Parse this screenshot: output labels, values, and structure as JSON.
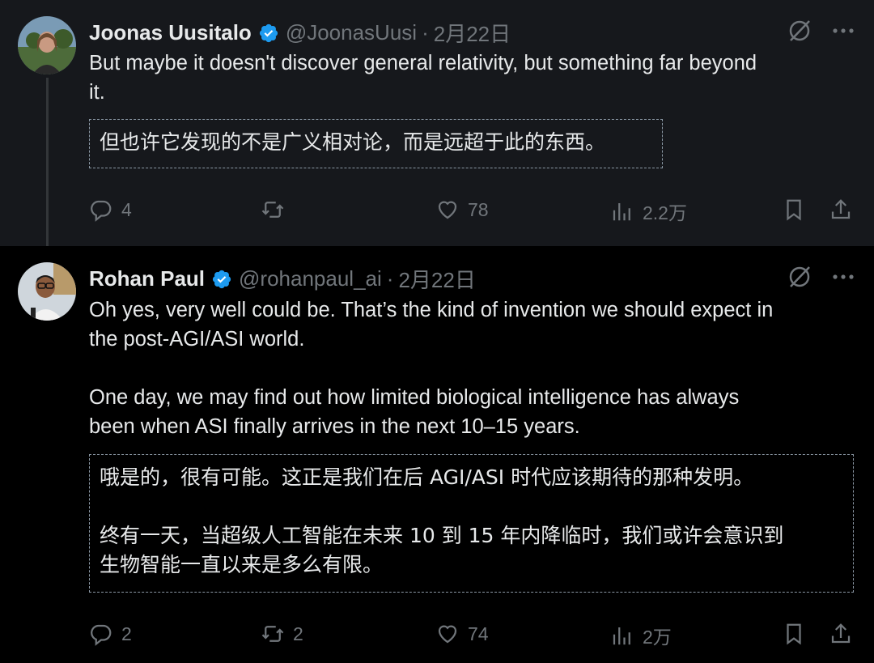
{
  "tweets": [
    {
      "author": "Joonas Uusitalo",
      "handle": "@JoonasUusi",
      "separator": "·",
      "date": "2月22日",
      "text": "But maybe it doesn't discover general relativity, but something far beyond\nit.",
      "translation": "但也许它发现的不是广义相对论，而是远超于此的东西。",
      "replies": "4",
      "retweets": "",
      "likes": "78",
      "views": "2.2万"
    },
    {
      "author": "Rohan Paul",
      "handle": "@rohanpaul_ai",
      "separator": "·",
      "date": "2月22日",
      "text": "Oh yes, very well could be. That’s the kind of invention we should expect in\nthe post-AGI/ASI world.\n\nOne day, we may find out how limited biological intelligence has always\nbeen when ASI finally arrives in the next 10–15 years.",
      "translation": "哦是的，很有可能。这正是我们在后 AGI/ASI 时代应该期待的那种发明。\n\n终有一天，当超级人工智能在未来 10 到 15 年内降临时，我们或许会意识到\n生物智能一直以来是多么有限。",
      "replies": "2",
      "retweets": "2",
      "likes": "74",
      "views": "2万"
    }
  ],
  "colors": {
    "verified": "#1d9bf0",
    "muted": "#71767b",
    "text": "#e7e9ea"
  },
  "icons": [
    "verified-badge-icon",
    "grok-icon",
    "more-icon",
    "reply-icon",
    "retweet-icon",
    "like-icon",
    "views-icon",
    "bookmark-icon",
    "share-icon"
  ]
}
